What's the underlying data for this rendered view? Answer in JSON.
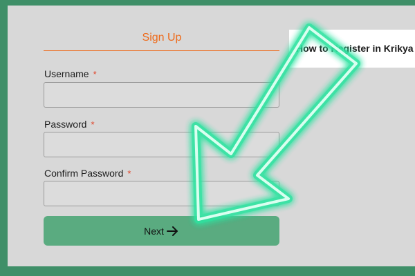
{
  "form": {
    "title": "Sign Up",
    "username": {
      "label": "Username",
      "required_mark": "*",
      "value": "",
      "placeholder": ""
    },
    "password": {
      "label": "Password",
      "required_mark": "*",
      "value": "",
      "placeholder": ""
    },
    "confirm_password": {
      "label": "Confirm Password",
      "required_mark": "*",
      "value": "",
      "placeholder": ""
    },
    "next_button": {
      "label": "Next",
      "icon": "arrow-right-icon"
    }
  },
  "callout": {
    "text": "How to Register in Krikya"
  },
  "overlay": {
    "icon": "neon-arrow-icon",
    "color": "#2fe3a0"
  },
  "colors": {
    "accent": "#ee6a1a",
    "required": "#e0452a",
    "button": "#5aab80",
    "frame": "#3f8f68",
    "panel": "#d8d8d8"
  }
}
